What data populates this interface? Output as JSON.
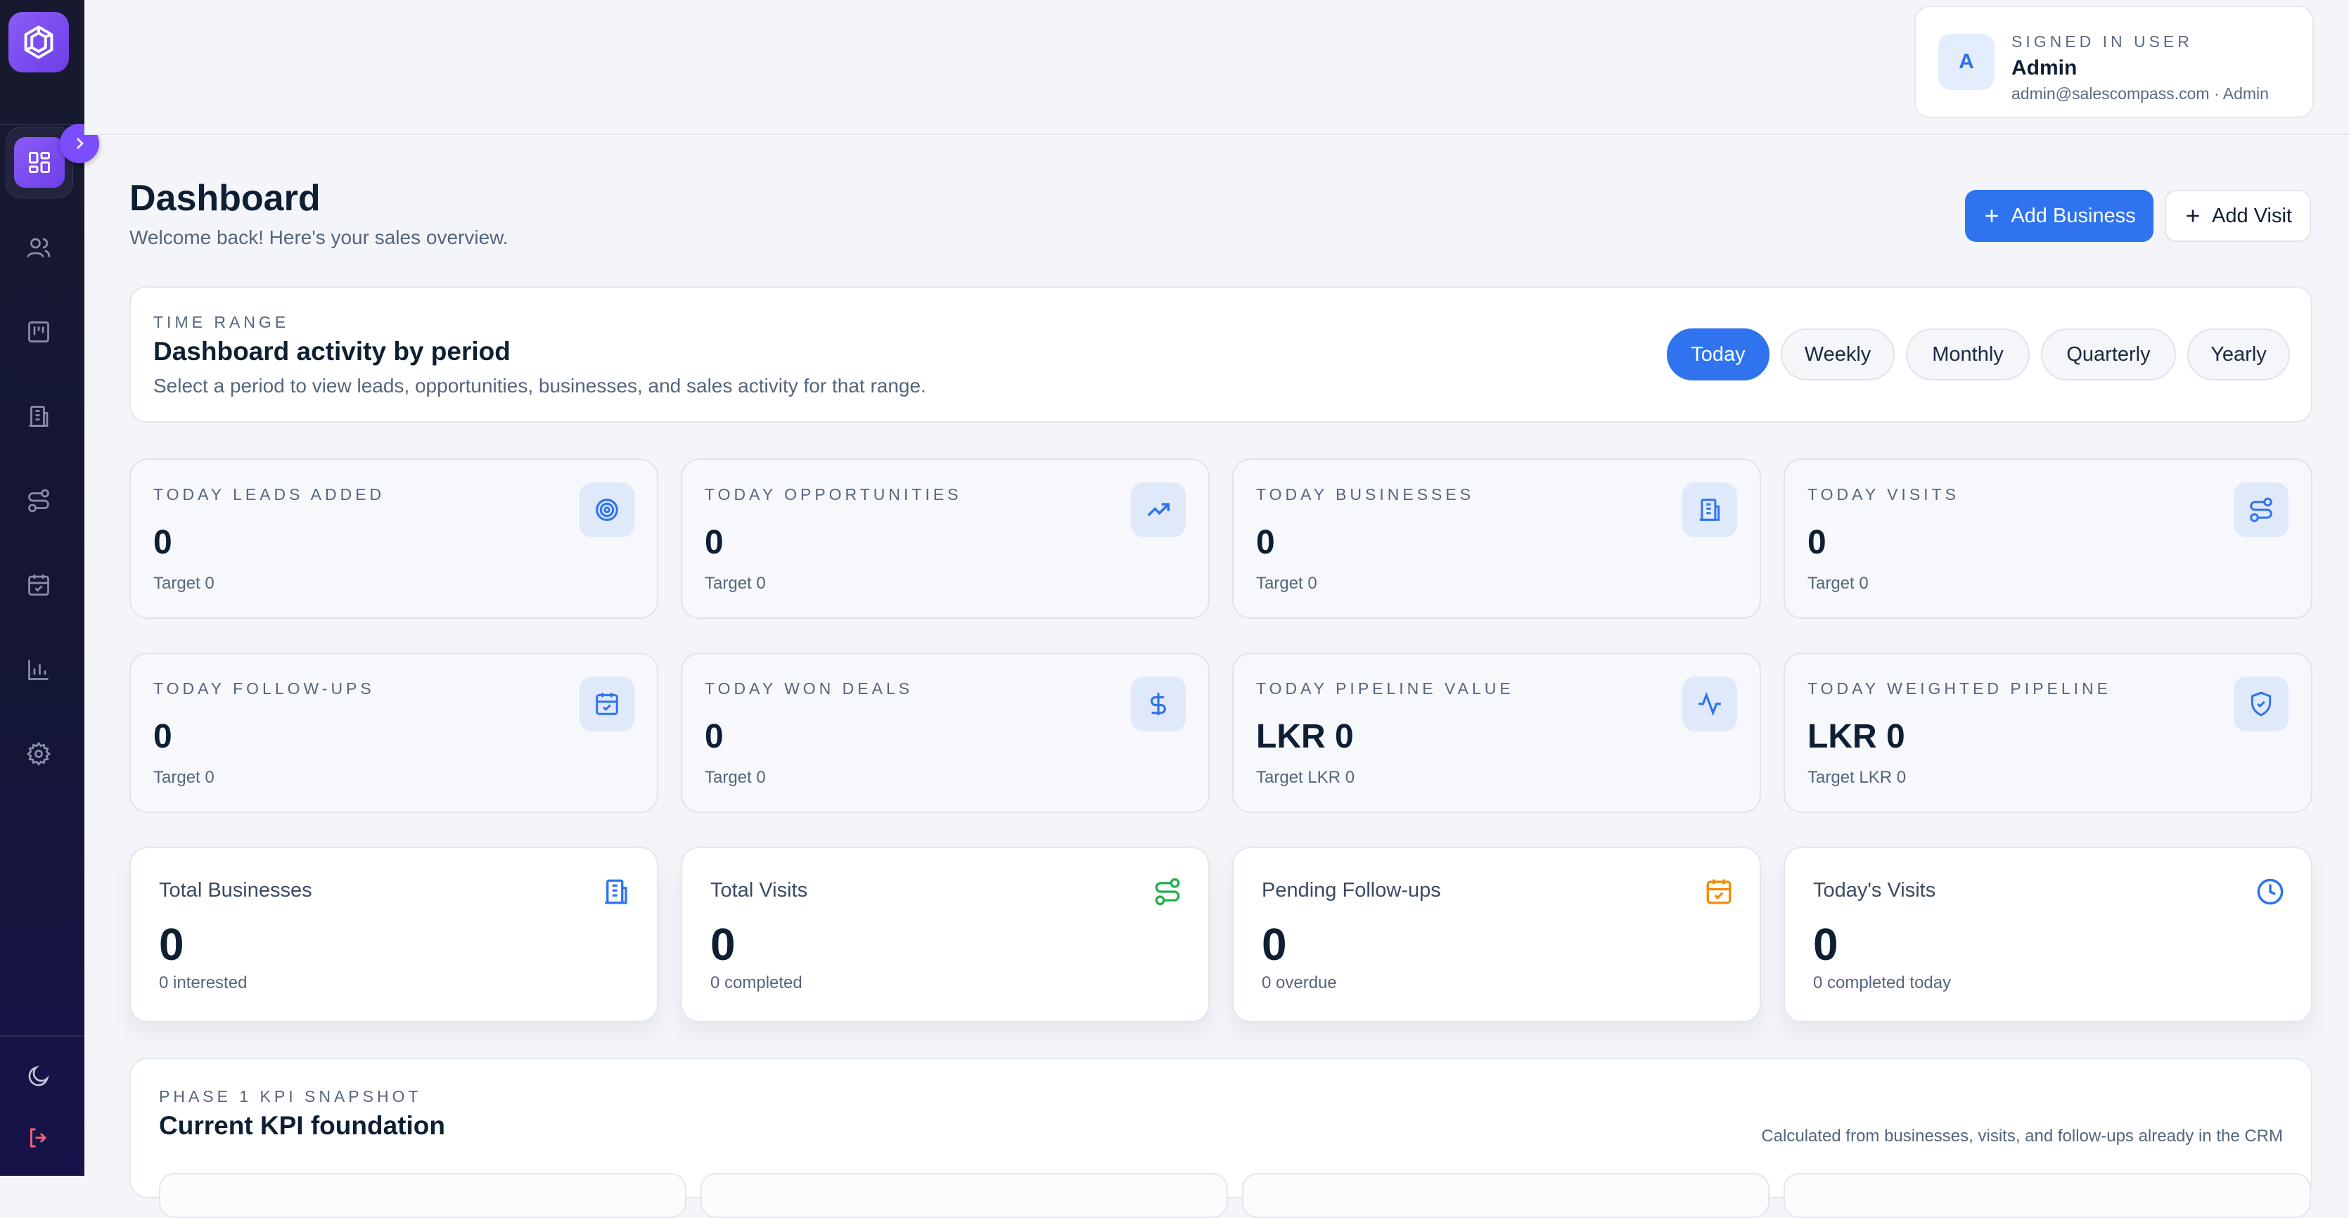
{
  "sidebar": {
    "logo_icon": "hexagon-logo-icon",
    "items": [
      {
        "icon": "dashboard-grid-icon",
        "active": true
      },
      {
        "icon": "users-icon"
      },
      {
        "icon": "kanban-board-icon"
      },
      {
        "icon": "building-icon"
      },
      {
        "icon": "route-icon"
      },
      {
        "icon": "calendar-check-icon"
      },
      {
        "icon": "bar-chart-icon"
      },
      {
        "icon": "gear-icon"
      }
    ],
    "bottom": [
      {
        "icon": "moon-icon"
      },
      {
        "icon": "logout-icon"
      }
    ]
  },
  "user": {
    "kicker": "SIGNED IN USER",
    "avatar": "A",
    "name": "Admin",
    "meta": "admin@salescompass.com · Admin"
  },
  "header": {
    "title": "Dashboard",
    "subtitle": "Welcome back! Here's your sales overview.",
    "add_business": "Add Business",
    "add_visit": "Add Visit"
  },
  "time_range": {
    "kicker": "TIME RANGE",
    "title": "Dashboard activity by period",
    "subtitle": "Select a period to view leads, opportunities, businesses, and sales activity for that range.",
    "options": [
      "Today",
      "Weekly",
      "Monthly",
      "Quarterly",
      "Yearly"
    ],
    "selected": "Today"
  },
  "kpis": [
    {
      "label": "TODAY LEADS ADDED",
      "value": "0",
      "target": "Target 0",
      "icon": "target-icon"
    },
    {
      "label": "TODAY OPPORTUNITIES",
      "value": "0",
      "target": "Target 0",
      "icon": "trending-up-icon"
    },
    {
      "label": "TODAY BUSINESSES",
      "value": "0",
      "target": "Target 0",
      "icon": "building-icon"
    },
    {
      "label": "TODAY VISITS",
      "value": "0",
      "target": "Target 0",
      "icon": "route-icon"
    },
    {
      "label": "TODAY FOLLOW-UPS",
      "value": "0",
      "target": "Target 0",
      "icon": "calendar-check-icon"
    },
    {
      "label": "TODAY WON DEALS",
      "value": "0",
      "target": "Target 0",
      "icon": "dollar-icon"
    },
    {
      "label": "TODAY PIPELINE VALUE",
      "value": "LKR 0",
      "target": "Target LKR 0",
      "icon": "activity-icon"
    },
    {
      "label": "TODAY WEIGHTED PIPELINE",
      "value": "LKR 0",
      "target": "Target LKR 0",
      "icon": "shield-check-icon"
    }
  ],
  "stats": [
    {
      "label": "Total Businesses",
      "value": "0",
      "sub": "0 interested",
      "icon": "building-icon",
      "color": "#2f74ee"
    },
    {
      "label": "Total Visits",
      "value": "0",
      "sub": "0 completed",
      "icon": "route-icon",
      "color": "#22b04c"
    },
    {
      "label": "Pending Follow-ups",
      "value": "0",
      "sub": "0 overdue",
      "icon": "calendar-check-icon",
      "color": "#f08c00"
    },
    {
      "label": "Today's Visits",
      "value": "0",
      "sub": "0 completed today",
      "icon": "clock-icon",
      "color": "#2f74ee"
    }
  ],
  "snapshot": {
    "kicker": "PHASE 1 KPI SNAPSHOT",
    "title": "Current KPI foundation",
    "note": "Calculated from businesses, visits, and follow-ups already in the CRM"
  },
  "colors": {
    "accent": "#2f74ee",
    "sidebar_accent": "#7c4dff",
    "text": "#0f1f33"
  }
}
